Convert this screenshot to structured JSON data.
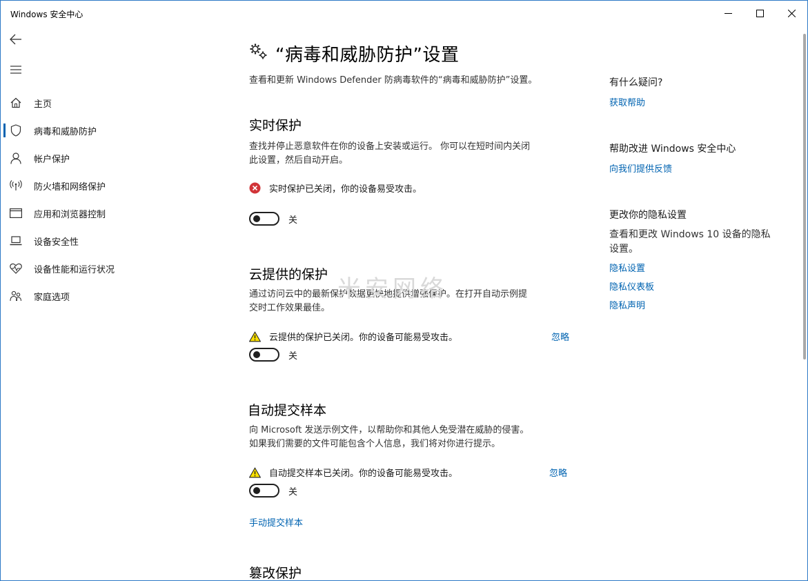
{
  "window": {
    "title": "Windows 安全中心"
  },
  "sidebar": {
    "items": [
      {
        "label": "主页",
        "icon": "home-icon"
      },
      {
        "label": "病毒和威胁防护",
        "icon": "shield-icon",
        "active": true
      },
      {
        "label": "帐户保护",
        "icon": "person-icon"
      },
      {
        "label": "防火墙和网络保护",
        "icon": "wifi-signal-icon"
      },
      {
        "label": "应用和浏览器控制",
        "icon": "app-window-icon"
      },
      {
        "label": "设备安全性",
        "icon": "laptop-icon"
      },
      {
        "label": "设备性能和运行状况",
        "icon": "heart-pulse-icon"
      },
      {
        "label": "家庭选项",
        "icon": "family-icon"
      }
    ]
  },
  "main": {
    "title": "“病毒和威胁防护”设置",
    "description": "查看和更新 Windows Defender 防病毒软件的“病毒和威胁防护”设置。",
    "sections": [
      {
        "title": "实时保护",
        "desc_line1": "查找并停止恶意软件在你的设备上安装或运行。 你可以在短时间内关闭",
        "desc_line2": "此设置，然后自动开启。",
        "status": "实时保护已关闭，你的设备易受攻击。",
        "status_type": "error",
        "toggle_label": "关"
      },
      {
        "title": "云提供的保护",
        "desc_line1": "通过访问云中的最新保护数据更快地提供增强保护。在打开自动示例提",
        "desc_line2": "交时工作效果最佳。",
        "status": "云提供的保护已关闭。你的设备可能易受攻击。",
        "status_type": "warning",
        "dismiss": "忽略",
        "toggle_label": "关"
      },
      {
        "title": "自动提交样本",
        "desc_line1": "向 Microsoft 发送示例文件，以帮助你和其他人免受潜在威胁的侵害。",
        "desc_line2": "如果我们需要的文件可能包含个人信息，我们将对你进行提示。",
        "status": "自动提交样本已关闭。你的设备可能易受攻击。",
        "status_type": "warning",
        "dismiss": "忽略",
        "toggle_label": "关",
        "link": "手动提交样本"
      },
      {
        "title": "篡改保护"
      }
    ]
  },
  "right_panel": {
    "question_heading": "有什么疑问?",
    "get_help": "获取帮助",
    "improve_heading": "帮助改进 Windows 安全中心",
    "feedback": "向我们提供反馈",
    "privacy_heading": "更改你的隐私设置",
    "privacy_text_line1": "查看和更改 Windows 10 设备的隐私",
    "privacy_text_line2": "设置。",
    "privacy_links": [
      "隐私设置",
      "隐私仪表板",
      "隐私声明"
    ]
  },
  "watermark": "米安网络",
  "colors": {
    "accent": "#0063b1",
    "error": "#d13438",
    "warning": "#fce100",
    "window_border": "#2b78c5"
  }
}
